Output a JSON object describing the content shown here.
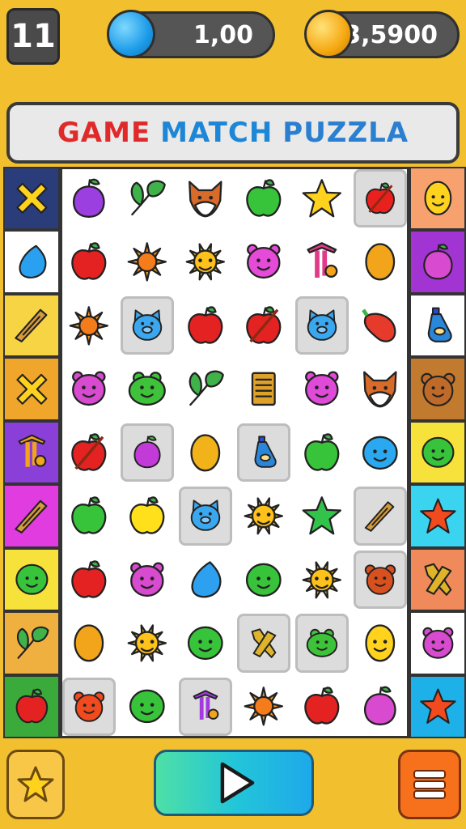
{
  "hud": {
    "level": "11",
    "gems": "1,00",
    "coins": "23,5900"
  },
  "title": {
    "word1": "GAME",
    "word2": "MATCH",
    "word3": "PUZZLA"
  },
  "colors": {
    "background": "#f2bf2e",
    "board": "#ffffff",
    "highlight": "#dcdcdc"
  },
  "left_column": [
    {
      "icon": "x-icon",
      "bg": "#2a3d7a"
    },
    {
      "icon": "drop-icon",
      "bg": "#ffffff"
    },
    {
      "icon": "wood-icon",
      "bg": "#f6d443"
    },
    {
      "icon": "x-icon",
      "bg": "#f0a62a"
    },
    {
      "icon": "pin-icon",
      "bg": "#8a3fd8"
    },
    {
      "icon": "wood-icon",
      "bg": "#e03ce0"
    },
    {
      "icon": "blob-icon",
      "bg": "#f6e23a"
    },
    {
      "icon": "leaf-icon",
      "bg": "#f0b040"
    },
    {
      "icon": "apple-icon",
      "bg": "#3aaa3a"
    }
  ],
  "right_column": [
    {
      "icon": "lemon-icon",
      "bg": "#f7a26e"
    },
    {
      "icon": "plum-icon",
      "bg": "#a234d4"
    },
    {
      "icon": "bottle-icon",
      "bg": "#ffffff"
    },
    {
      "icon": "bear-icon",
      "bg": "#c27a2e"
    },
    {
      "icon": "blob-icon",
      "bg": "#f6e23a"
    },
    {
      "icon": "star-icon",
      "bg": "#3ad4f0"
    },
    {
      "icon": "bone-icon",
      "bg": "#f08a5a"
    },
    {
      "icon": "pig-icon",
      "bg": "#ffffff"
    },
    {
      "icon": "star-icon",
      "bg": "#1eb0e8"
    }
  ],
  "grid": [
    [
      "plum-icon",
      "leaf-icon",
      "fox-icon",
      "apple-icon",
      "star-icon",
      "slash-apple-icon"
    ],
    [
      "apple-icon",
      "sun-icon",
      "sunface-icon",
      "pig-icon",
      "pin-icon",
      "lemon-icon"
    ],
    [
      "sun-icon",
      "cat-icon",
      "apple-icon",
      "slash-apple-icon",
      "cat-icon",
      "pepper-icon"
    ],
    [
      "pig-icon",
      "frog-icon",
      "leaf-icon",
      "book-icon",
      "pig-icon",
      "fox-icon"
    ],
    [
      "slash-apple-icon",
      "plum-icon",
      "lemon-icon",
      "bottle-icon",
      "apple-icon",
      "blob-icon"
    ],
    [
      "apple-icon",
      "apple-icon",
      "cat-icon",
      "sunface-icon",
      "star-icon",
      "wood-icon"
    ],
    [
      "apple-icon",
      "pig-icon",
      "drop-icon",
      "blob-icon",
      "sunface-icon",
      "bear-icon"
    ],
    [
      "lemon-icon",
      "sunface-icon",
      "blob-icon",
      "bone-icon",
      "frog-icon",
      "lemon-icon"
    ],
    [
      "bear-icon",
      "blob-icon",
      "pin-icon",
      "sun-icon",
      "apple-icon",
      "plum-icon"
    ]
  ],
  "grid_colors": [
    [
      "#9b3fe0",
      "#3fb24a",
      "#d86a2a",
      "#38c43a",
      "#ffd21e",
      "#e8201e"
    ],
    [
      "#e52222",
      "#ff9c1a",
      "#ffc21a",
      "#e64ad8",
      "#e03a8a",
      "#f2a41a"
    ],
    [
      "#ff9c1a",
      "#3aa8f0",
      "#e52222",
      "#e52222",
      "#3aa8f0",
      "#e63a2a"
    ],
    [
      "#d84ad0",
      "#3ec23a",
      "#3fb24a",
      "#e0a12a",
      "#e04ad8",
      "#d86a2a"
    ],
    [
      "#e52222",
      "#c23ad8",
      "#f2b21a",
      "#2a86d8",
      "#38c43a",
      "#2aa8f0"
    ],
    [
      "#38c43a",
      "#ffe01a",
      "#3aa8f0",
      "#ffc21a",
      "#32c44a",
      "#d49a3a"
    ],
    [
      "#e52222",
      "#d84ad0",
      "#2ea0f0",
      "#38c43a",
      "#ffc21a",
      "#d8501e"
    ],
    [
      "#f2a41a",
      "#ffc21a",
      "#38c43a",
      "#e0b42a",
      "#3ec23a",
      "#ffd21e"
    ],
    [
      "#f04a1e",
      "#38c43a",
      "#a23ae0",
      "#ff9c1a",
      "#e52222",
      "#d84ad0"
    ]
  ],
  "highlight": [
    [
      false,
      false,
      false,
      false,
      false,
      true
    ],
    [
      false,
      false,
      false,
      false,
      false,
      false
    ],
    [
      false,
      true,
      false,
      false,
      true,
      false
    ],
    [
      false,
      false,
      false,
      false,
      false,
      false
    ],
    [
      false,
      true,
      false,
      true,
      false,
      false
    ],
    [
      false,
      false,
      true,
      false,
      false,
      true
    ],
    [
      false,
      false,
      false,
      false,
      false,
      true
    ],
    [
      false,
      false,
      false,
      true,
      true,
      false
    ],
    [
      true,
      false,
      true,
      false,
      false,
      false
    ]
  ],
  "side_colors": {
    "left": [
      "#ffd21e",
      "#2aa0f0",
      "#d89a3a",
      "#ffd21e",
      "#f2a41a",
      "#d89a3a",
      "#38c43a",
      "#3fb24a",
      "#e52222"
    ],
    "right": [
      "#ffd21e",
      "#d84ad0",
      "#2a86d8",
      "#c06a2a",
      "#38c43a",
      "#f04a1e",
      "#e0b42a",
      "#d84ad0",
      "#f04a1e"
    ]
  },
  "buttons": {
    "left": "star-button",
    "center": "play-button",
    "right": "menu-button"
  }
}
